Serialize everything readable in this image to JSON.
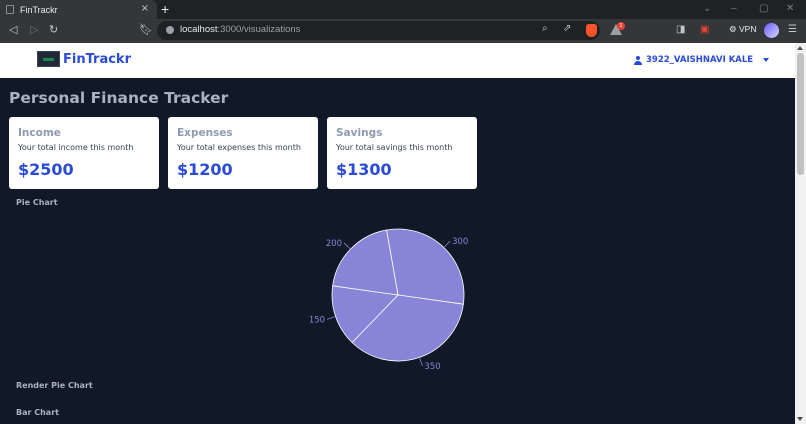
{
  "browser": {
    "tab_title": "FinTrackr",
    "tab_close": "×",
    "new_tab": "+",
    "url_host": "localhost",
    "url_path": ":3000/visualizations",
    "vpn_label": "VPN",
    "extension_badge": "1"
  },
  "navbar": {
    "brand": "FinTrackr",
    "user_name": "3922_VAISHNAVI KALE"
  },
  "page": {
    "title": "Personal Finance Tracker"
  },
  "cards": [
    {
      "title": "Income",
      "subtitle": "Your total income this month",
      "value": "$2500"
    },
    {
      "title": "Expenses",
      "subtitle": "Your total expenses this month",
      "value": "$1200"
    },
    {
      "title": "Savings",
      "subtitle": "Your total savings this month",
      "value": "$1300"
    }
  ],
  "sections": {
    "pie_chart_label": "Pie Chart",
    "render_pie_label": "Render Pie Chart",
    "bar_chart_label": "Bar Chart"
  },
  "chart_data": {
    "type": "pie",
    "values": [
      300,
      350,
      150,
      200
    ],
    "labels": [
      "300",
      "350",
      "150",
      "200"
    ],
    "colors": [
      "#8884d8"
    ],
    "title": "",
    "stroke": "#ffffff"
  }
}
